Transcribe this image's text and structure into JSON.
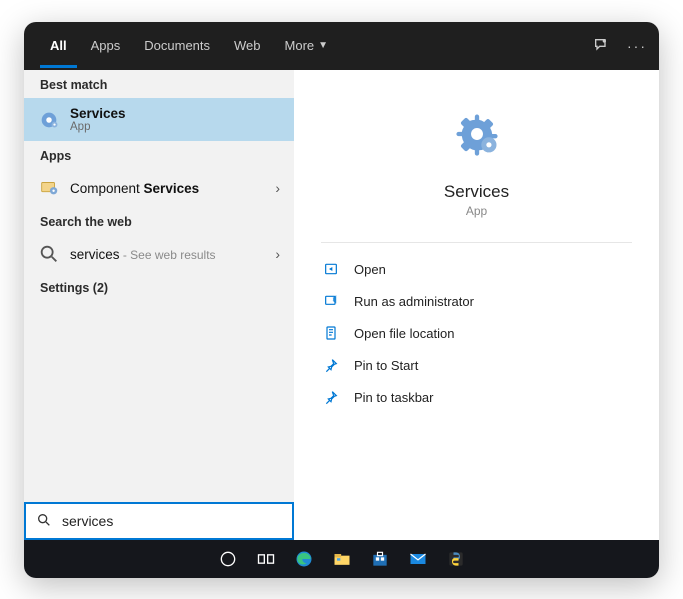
{
  "header": {
    "tabs": {
      "all": "All",
      "apps": "Apps",
      "documents": "Documents",
      "web": "Web",
      "more": "More"
    }
  },
  "sections": {
    "best_match": "Best match",
    "apps": "Apps",
    "search_web": "Search the web",
    "settings": "Settings (2)"
  },
  "results": {
    "best": {
      "title": "Services",
      "subtitle": "App"
    },
    "apps": {
      "prefix": "Component ",
      "bold": "Services"
    },
    "web": {
      "query": "services",
      "suffix": " - See web results"
    }
  },
  "preview": {
    "title": "Services",
    "subtitle": "App"
  },
  "actions": {
    "open": "Open",
    "run_admin": "Run as administrator",
    "open_loc": "Open file location",
    "pin_start": "Pin to Start",
    "pin_taskbar": "Pin to taskbar"
  },
  "search": {
    "value": "services"
  }
}
